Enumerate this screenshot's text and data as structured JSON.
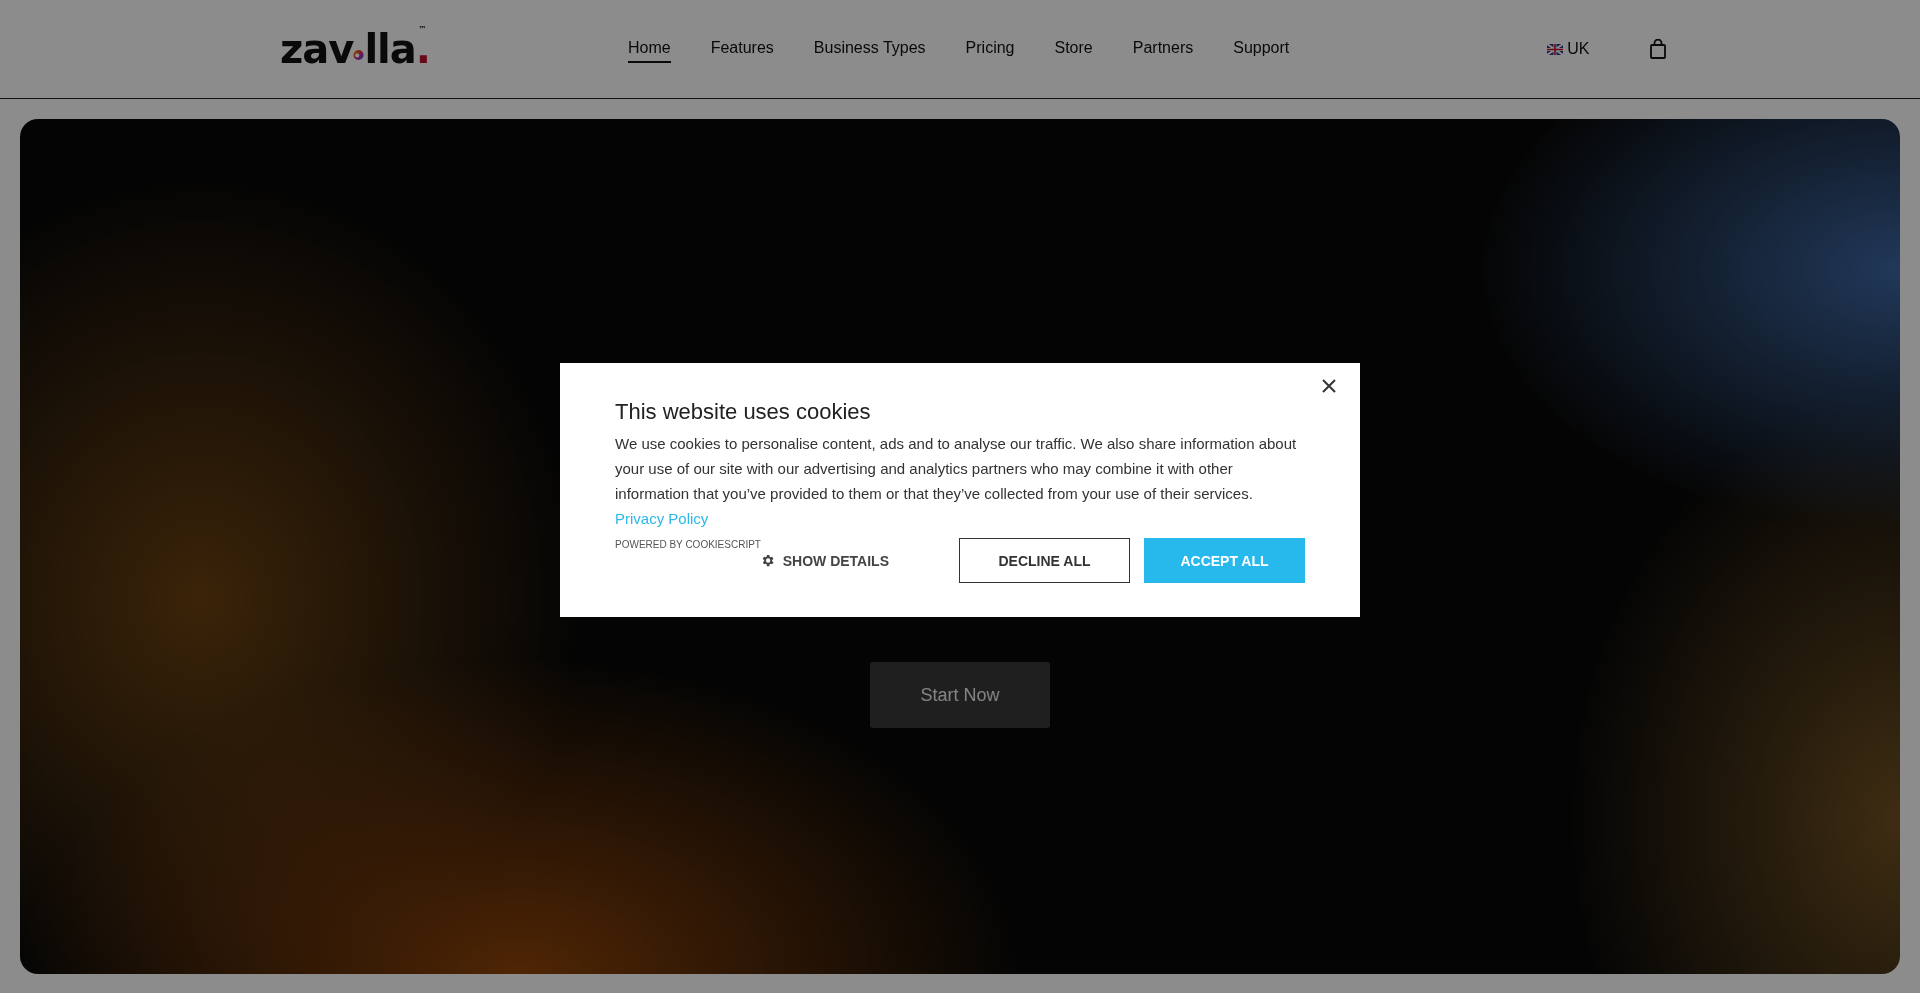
{
  "header": {
    "logo": {
      "prefix": "zav",
      "suffix": "lla",
      "dot": ".",
      "trademark": "™"
    },
    "nav": [
      {
        "label": "Home",
        "selected": true
      },
      {
        "label": "Features",
        "selected": false
      },
      {
        "label": "Business Types",
        "selected": false
      },
      {
        "label": "Pricing",
        "selected": false
      },
      {
        "label": "Store",
        "selected": false
      },
      {
        "label": "Partners",
        "selected": false
      },
      {
        "label": "Support",
        "selected": false
      }
    ],
    "language": "UK"
  },
  "hero": {
    "button": "Start Now"
  },
  "cookie_dialog": {
    "title": "This website uses cookies",
    "body": "We use cookies to personalise content, ads and to analyse our traffic. We also share information about your use of our site with our advertising and analytics partners who may combine it with other information that you’ve provided to them or that they’ve collected from your use of their services.",
    "link": "Privacy Policy",
    "powered_by": "POWERED BY COOKIESCRIPT",
    "show_details": "SHOW DETAILS",
    "decline": "DECLINE ALL",
    "accept": "ACCEPT ALL"
  }
}
